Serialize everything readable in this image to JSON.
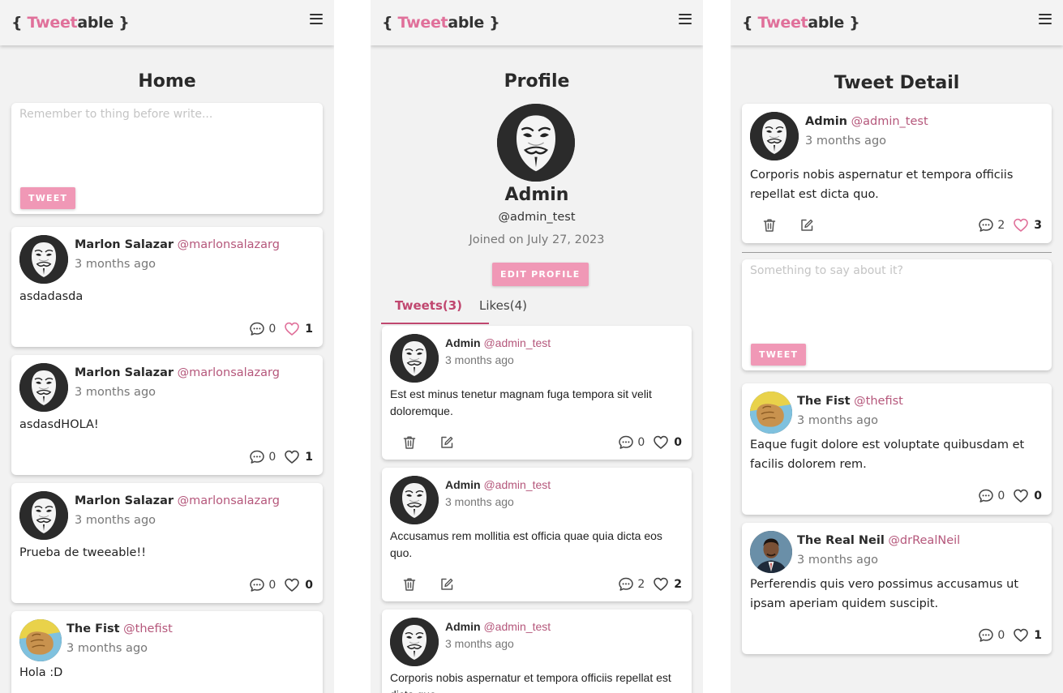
{
  "app": {
    "logo_open": "{ ",
    "logo_accent": "Tweet",
    "logo_rest": "able",
    "logo_close": " }",
    "accent_color": "#e0709a",
    "button_color": "#f098b6"
  },
  "home": {
    "title": "Home",
    "compose": {
      "placeholder": "Remember to thing before write...",
      "button": "TWEET"
    },
    "tweets": [
      {
        "name": "Marlon Salazar",
        "handle": "@marlonsalazarg",
        "time": "3 months ago",
        "text": "asdadasda",
        "comments": "0",
        "likes": "1",
        "liked": true
      },
      {
        "name": "Marlon Salazar",
        "handle": "@marlonsalazarg",
        "time": "3 months ago",
        "text": "asdasdHOLA!",
        "comments": "0",
        "likes": "1",
        "liked": false
      },
      {
        "name": "Marlon Salazar",
        "handle": "@marlonsalazarg",
        "time": "3 months ago",
        "text": "Prueba de tweeable!!",
        "comments": "0",
        "likes": "0",
        "liked": false
      },
      {
        "name": "The Fist",
        "handle": "@thefist",
        "time": "3 months ago",
        "text": "Hola :D"
      }
    ]
  },
  "profile": {
    "title": "Profile",
    "name": "Admin",
    "handle": "@admin_test",
    "joined": "Joined on July 27, 2023",
    "edit_button": "EDIT PROFILE",
    "tabs": [
      {
        "label": "Tweets(3)",
        "active": true
      },
      {
        "label": "Likes(4)",
        "active": false
      }
    ],
    "tweets": [
      {
        "name": "Admin",
        "handle": "@admin_test",
        "time": "3 months ago",
        "text": "Est est minus tenetur magnam fuga tempora sit velit doloremque.",
        "comments": "0",
        "likes": "0"
      },
      {
        "name": "Admin",
        "handle": "@admin_test",
        "time": "3 months ago",
        "text": "Accusamus rem mollitia est officia quae quia dicta eos quo.",
        "comments": "2",
        "likes": "2"
      },
      {
        "name": "Admin",
        "handle": "@admin_test",
        "time": "3 months ago",
        "text": "Corporis nobis aspernatur et tempora officiis repellat est dicta quo."
      }
    ]
  },
  "detail": {
    "title": "Tweet Detail",
    "main": {
      "name": "Admin",
      "handle": "@admin_test",
      "time": "3 months ago",
      "text": "Corporis nobis aspernatur et tempora officiis repellat est dicta quo.",
      "comments": "2",
      "likes": "3",
      "liked": true
    },
    "reply": {
      "placeholder": "Something to say about it?",
      "button": "TWEET"
    },
    "replies": [
      {
        "name": "The Fist",
        "handle": "@thefist",
        "time": "3 months ago",
        "text": "Eaque fugit dolore est voluptate quibusdam et facilis dolorem rem.",
        "comments": "0",
        "likes": "0"
      },
      {
        "name": "The Real Neil",
        "handle": "@drRealNeil",
        "time": "3 months ago",
        "text": "Perferendis quis vero possimus accusamus ut ipsam aperiam quidem suscipit.",
        "comments": "0",
        "likes": "1"
      }
    ]
  }
}
